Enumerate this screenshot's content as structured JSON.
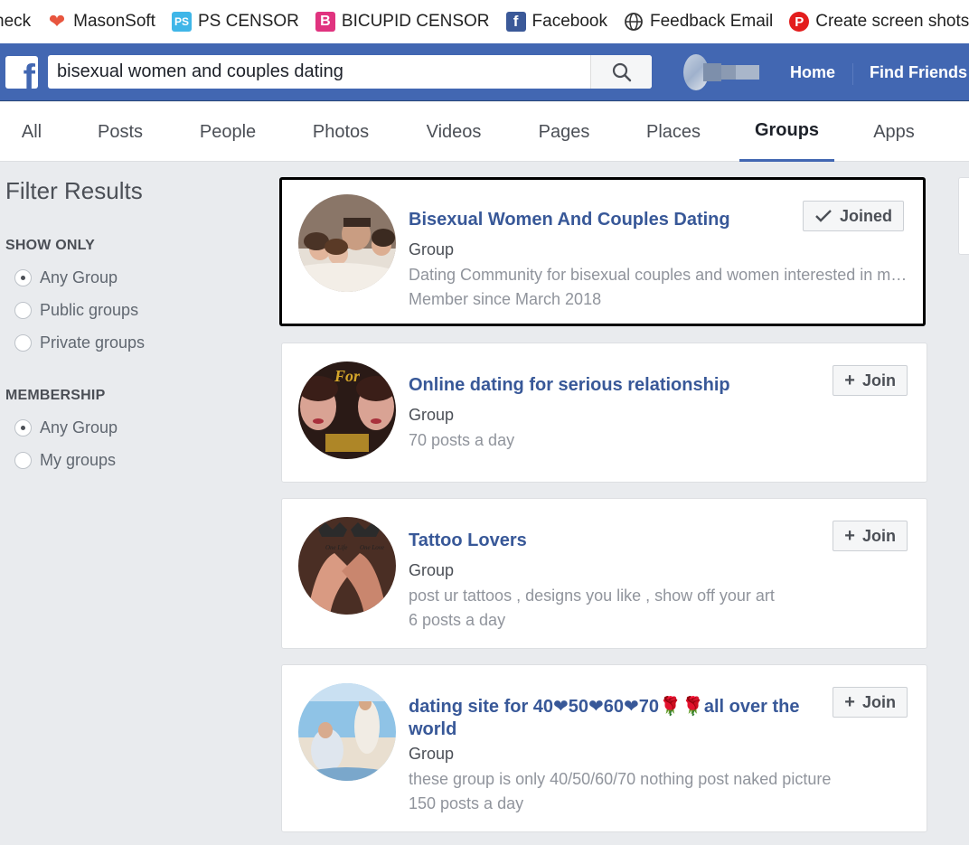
{
  "bookmarks": [
    {
      "label": "neck",
      "icon": "none"
    },
    {
      "label": "MasonSoft",
      "icon": "heart-icon"
    },
    {
      "label": "PS CENSOR",
      "icon": "ps-icon"
    },
    {
      "label": "BICUPID CENSOR",
      "icon": "bicupid-icon"
    },
    {
      "label": "Facebook",
      "icon": "facebook-icon"
    },
    {
      "label": "Feedback Email",
      "icon": "globe-icon"
    },
    {
      "label": "Create screen shots",
      "icon": "p-icon"
    }
  ],
  "header": {
    "search_value": "bisexual women and couples dating",
    "home_label": "Home",
    "find_friends_label": "Find Friends",
    "brand_color": "#4267b2"
  },
  "tabs": [
    {
      "label": "All"
    },
    {
      "label": "Posts"
    },
    {
      "label": "People"
    },
    {
      "label": "Photos"
    },
    {
      "label": "Videos"
    },
    {
      "label": "Pages"
    },
    {
      "label": "Places"
    },
    {
      "label": "Groups",
      "active": true
    },
    {
      "label": "Apps"
    }
  ],
  "sidebar": {
    "title": "Filter Results",
    "show_only": {
      "label": "SHOW ONLY",
      "options": [
        {
          "label": "Any Group",
          "checked": true
        },
        {
          "label": "Public groups",
          "checked": false
        },
        {
          "label": "Private groups",
          "checked": false
        }
      ]
    },
    "membership": {
      "label": "MEMBERSHIP",
      "options": [
        {
          "label": "Any Group",
          "checked": true
        },
        {
          "label": "My groups",
          "checked": false
        }
      ]
    }
  },
  "results": [
    {
      "title": "Bisexual Women And Couples Dating",
      "type": "Group",
      "description": "Dating Community for bisexual couples and women interested in meeting",
      "meta": "Member since March 2018",
      "button": "Joined"
    },
    {
      "title": "Online dating for serious relationship",
      "type": "Group",
      "description": "70 posts a day",
      "button": "Join"
    },
    {
      "title": "Tattoo Lovers",
      "type": "Group",
      "description": "post ur tattoos , designs you like , show off your art",
      "meta": "6 posts a day",
      "button": "Join"
    },
    {
      "title": "dating site for 40❤50❤60❤70🌹🌹all over the world",
      "type": "Group",
      "description": "these group is only 40/50/60/70 nothing post naked picture",
      "meta": "150 posts a day",
      "button": "Join"
    }
  ]
}
